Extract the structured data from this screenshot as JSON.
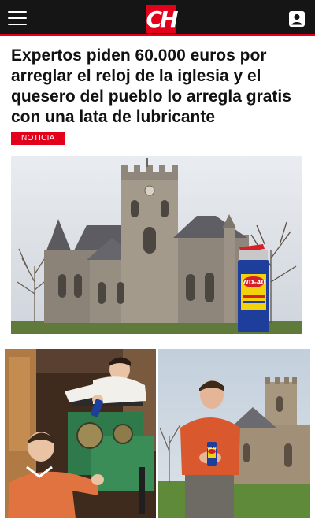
{
  "header": {
    "logo_text": "CH",
    "menu_icon": "hamburger-menu-icon",
    "user_icon": "user-account-icon",
    "brand_color": "#e3001b",
    "bar_color": "#151515"
  },
  "article": {
    "title": "Expertos piden 60.000 euros por arreglar el reloj de la iglesia y el quesero del pueblo lo arregla gratis con una lata de lubricante",
    "category": "NOTICIA"
  },
  "images": {
    "main_can_label": "WD-40",
    "left_can_label": "WD-40",
    "right_can_label": "WD-40"
  }
}
